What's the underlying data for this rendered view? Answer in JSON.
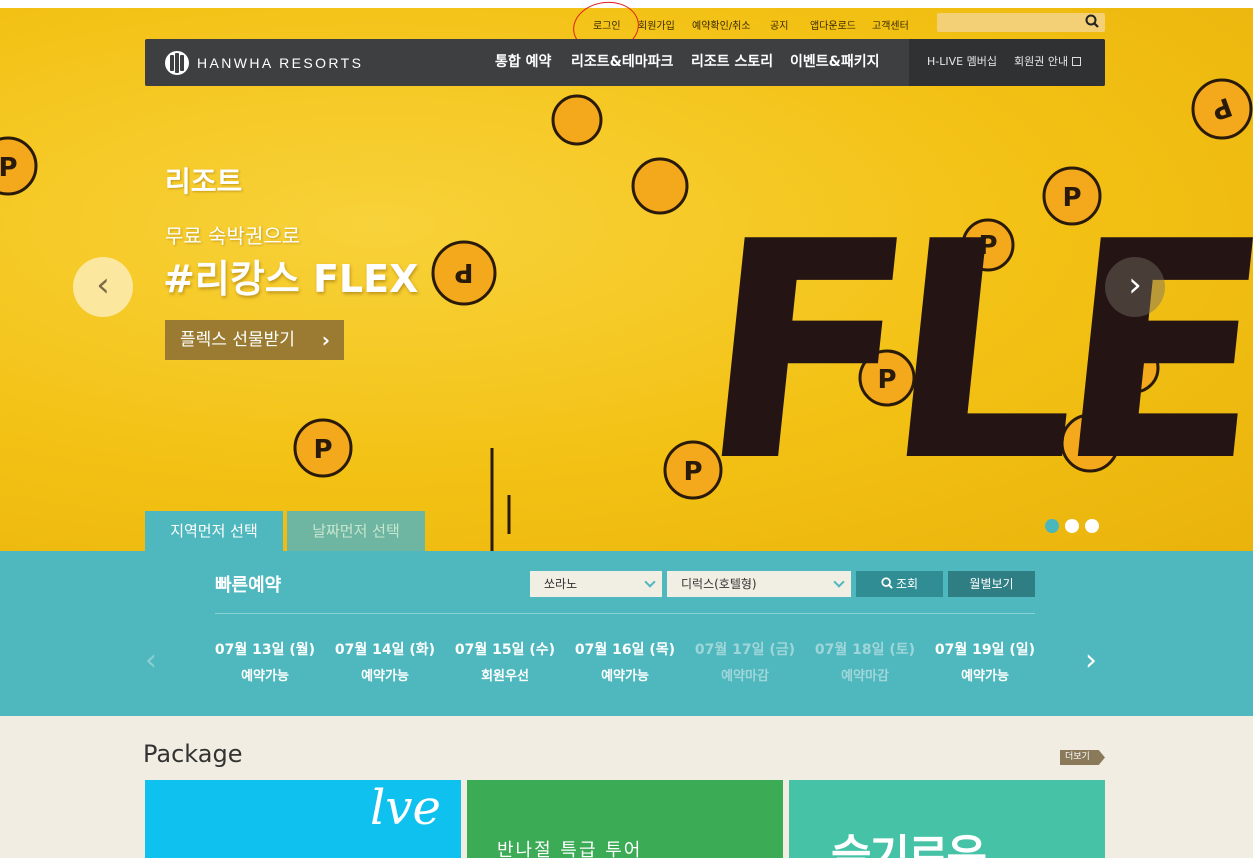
{
  "util_nav": {
    "login": "로그인",
    "signup": "회원가입",
    "reservation_check": "예약확인/취소",
    "notice": "공지",
    "app_download": "앱다운로드",
    "customer_center": "고객센터"
  },
  "search": {
    "placeholder": "",
    "icon": "search-icon"
  },
  "brand": {
    "name": "HANWHA RESORTS"
  },
  "gnb": {
    "items": [
      "통합 예약",
      "리조트&테마파크",
      "리조트 스토리",
      "이벤트&패키지"
    ],
    "sub_items": [
      "H-LIVE 멤버십",
      "회원권 안내"
    ]
  },
  "hero": {
    "category": "리조트",
    "subtitle": "무료 숙박권으로",
    "title": "#리캉스 FLEX",
    "button": "플렉스 선물받기",
    "art_text": "FLE",
    "prev": "‹",
    "next": "›",
    "slide_count": 3,
    "active_slide": 1
  },
  "tabs": {
    "region": "지역먼저 선택",
    "date": "날짜먼저 선택"
  },
  "quick": {
    "title": "빠른예약",
    "resort_select": "쏘라노",
    "room_select": "디럭스(호텔형)",
    "search_btn": "조회",
    "month_btn": "월별보기",
    "days": [
      {
        "date": "07월 13일 (월)",
        "status": "예약가능",
        "closed": false
      },
      {
        "date": "07월 14일 (화)",
        "status": "예약가능",
        "closed": false
      },
      {
        "date": "07월 15일 (수)",
        "status": "회원우선",
        "closed": false
      },
      {
        "date": "07월 16일 (목)",
        "status": "예약가능",
        "closed": false
      },
      {
        "date": "07월 17일 (금)",
        "status": "예약마감",
        "closed": true
      },
      {
        "date": "07월 18일 (토)",
        "status": "예약마감",
        "closed": true
      },
      {
        "date": "07월 19일 (일)",
        "status": "예약가능",
        "closed": false
      }
    ]
  },
  "package": {
    "title": "Package",
    "more": "더보기",
    "cards": [
      {
        "text": "",
        "script": "lve"
      },
      {
        "text": "반나절 특급 투어"
      },
      {
        "text": "슬기로운"
      }
    ]
  },
  "colors": {
    "hero_bg": "#f5c416",
    "gnb_bg": "#3d3f41",
    "teal": "#4fb8be",
    "package_bg": "#f2ede3",
    "login_annotation": "#e0201c"
  }
}
